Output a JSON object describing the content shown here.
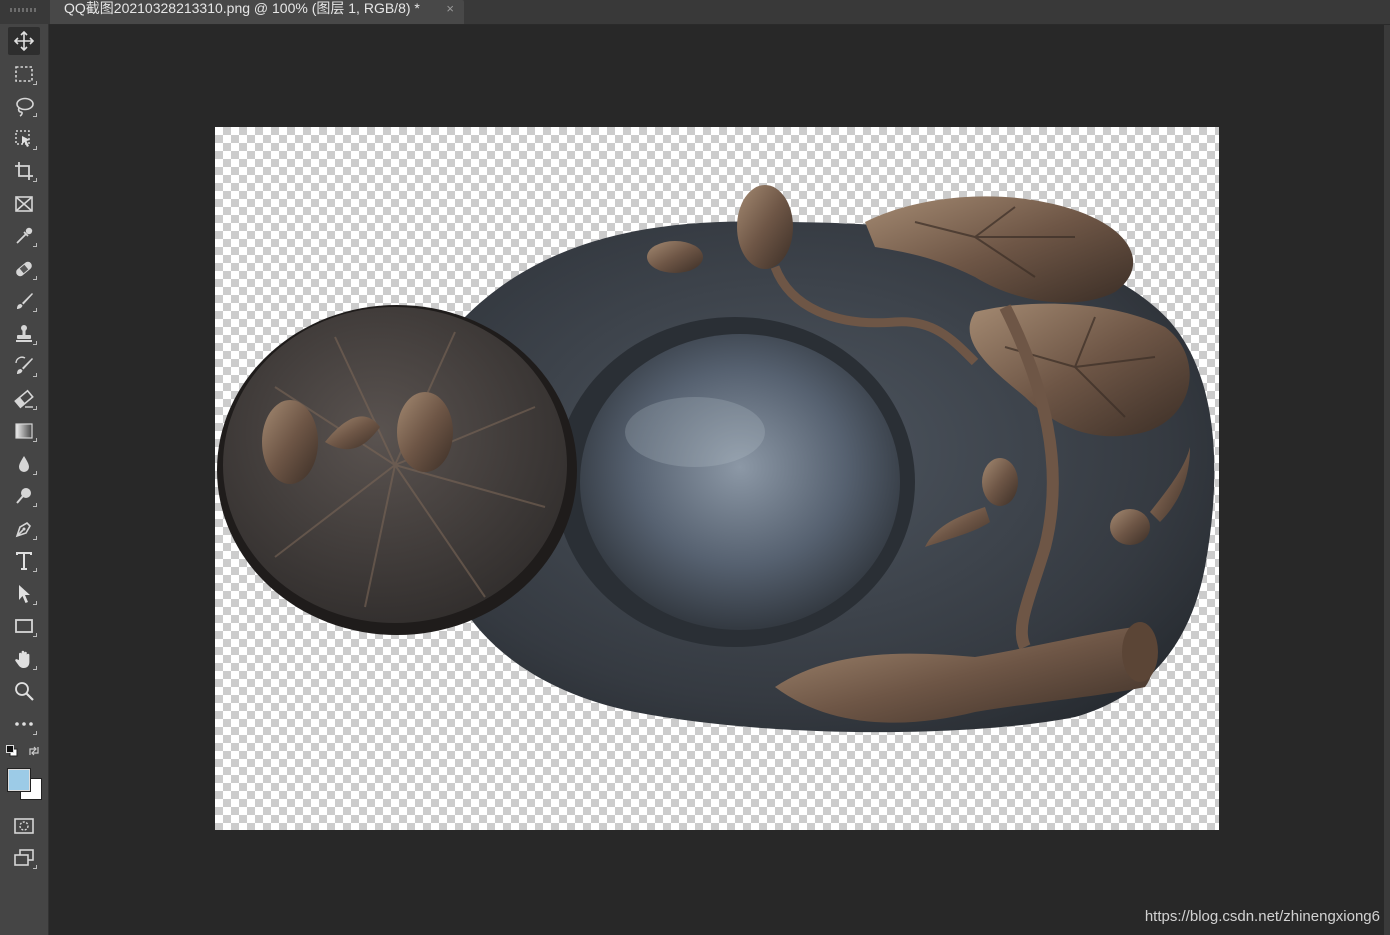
{
  "document_tab": {
    "title": "QQ截图20210328213310.png @ 100% (图层 1, RGB/8) *",
    "close_glyph": "×"
  },
  "toolbar": {
    "tools": [
      {
        "name": "move-tool",
        "icon": "move-icon"
      },
      {
        "name": "rectangular-marquee-tool",
        "icon": "marquee-icon"
      },
      {
        "name": "lasso-tool",
        "icon": "lasso-icon"
      },
      {
        "name": "object-selection-tool",
        "icon": "object-selection-icon"
      },
      {
        "name": "crop-tool",
        "icon": "crop-icon"
      },
      {
        "name": "frame-tool",
        "icon": "frame-icon"
      },
      {
        "name": "eyedropper-tool",
        "icon": "eyedropper-icon"
      },
      {
        "name": "healing-brush-tool",
        "icon": "bandage-icon"
      },
      {
        "name": "brush-tool",
        "icon": "brush-icon"
      },
      {
        "name": "clone-stamp-tool",
        "icon": "stamp-icon"
      },
      {
        "name": "history-brush-tool",
        "icon": "history-brush-icon"
      },
      {
        "name": "eraser-tool",
        "icon": "eraser-icon"
      },
      {
        "name": "gradient-tool",
        "icon": "gradient-icon"
      },
      {
        "name": "blur-tool",
        "icon": "drop-icon"
      },
      {
        "name": "dodge-tool",
        "icon": "dodge-icon"
      },
      {
        "name": "pen-tool",
        "icon": "pen-icon"
      },
      {
        "name": "type-tool",
        "icon": "type-icon"
      },
      {
        "name": "path-selection-tool",
        "icon": "arrow-icon"
      },
      {
        "name": "rectangle-tool",
        "icon": "rectangle-icon"
      },
      {
        "name": "hand-tool",
        "icon": "hand-icon"
      },
      {
        "name": "zoom-tool",
        "icon": "zoom-icon"
      },
      {
        "name": "edit-toolbar",
        "icon": "more-icon"
      }
    ],
    "foreground_color": "#9ccbe7",
    "background_color": "#ffffff"
  },
  "canvas": {
    "zoom": "100%",
    "image_subject": "inkstone-artwork"
  },
  "watermark": "https://blog.csdn.net/zhinengxiong6"
}
